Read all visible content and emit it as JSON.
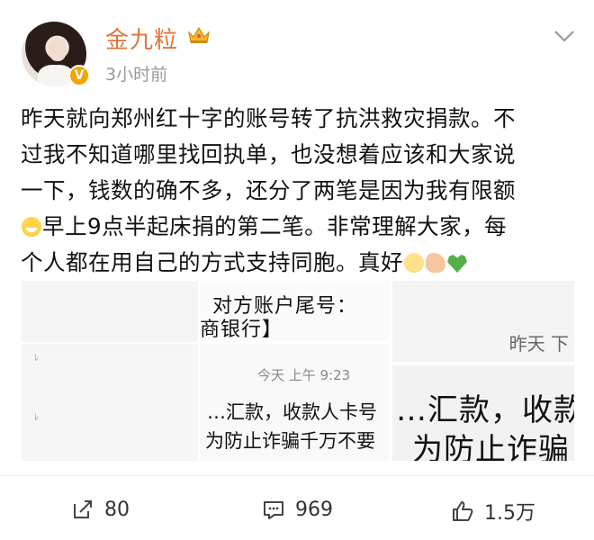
{
  "post": {
    "author": {
      "name": "金九粒",
      "verified_badge": "V"
    },
    "time": "3小时前",
    "text": {
      "line1": "昨天就向郑州红十字的账号转了抗洪救灾捐款。不",
      "line2": "过我不知道哪里找回执单，也没想着应该和大家说",
      "line3": "一下，钱数的确不多，还分了两笔是因为我有限额",
      "line4": "早上9点半起床捐的第二笔。非常理解大家，每",
      "line5": "个人都在用自己的方式支持同胞。真好"
    },
    "emoji": [
      "grinning-sweat-emoji",
      "smile-emoji",
      "flexed-biceps-emoji",
      "green-heart-emoji"
    ],
    "images": {
      "img2_line1": "对方账户尾号：",
      "img2_line2": "商银行】",
      "img3_text": "昨天 下",
      "img5_time": "今天 上午 9:23",
      "img5_line1": "…汇款，收款人卡号",
      "img5_line2": "为防止诈骗千万不要",
      "img6_line1": "…汇款，收款",
      "img6_line2": "为防止诈骗"
    }
  },
  "footer": {
    "share_count": "80",
    "comment_count": "969",
    "like_count": "1.5万"
  },
  "colors": {
    "username": "#e0753a",
    "badge": "#f4a300",
    "muted": "#999999"
  },
  "icons": [
    "crown-icon",
    "chevron-down-icon",
    "share-icon",
    "comment-icon",
    "like-icon"
  ]
}
